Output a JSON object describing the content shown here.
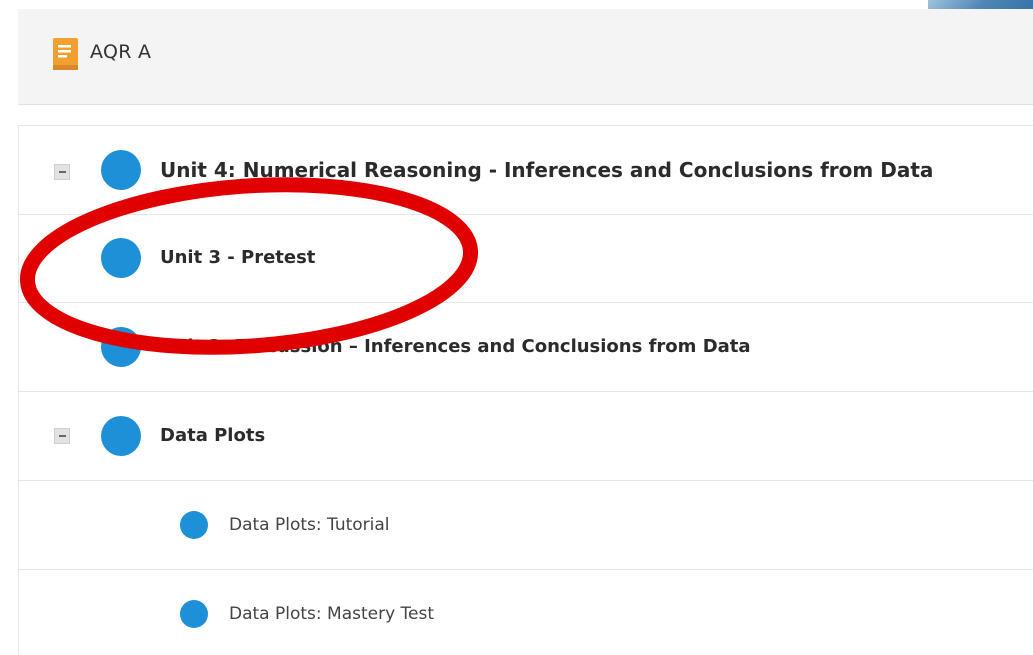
{
  "header": {
    "title": "AQR A",
    "icon": "book-icon"
  },
  "tree": {
    "items": [
      {
        "label": "Unit 4: Numerical Reasoning - Inferences and Conclusions from Data",
        "level": 1,
        "expanded": true
      },
      {
        "label": "Unit 3 - Pretest",
        "level": 2
      },
      {
        "label": "Unit 3: Discussion – Inferences and Conclusions from Data",
        "level": 2
      },
      {
        "label": "Data Plots",
        "level": 1,
        "expanded": true
      },
      {
        "label": "Data Plots: Tutorial",
        "level": 3
      },
      {
        "label": "Data Plots: Mastery Test",
        "level": 3
      }
    ]
  },
  "colors": {
    "accent_dot": "#1e90d8",
    "annotation_red": "#e00000",
    "book_icon": "#f0a030"
  }
}
